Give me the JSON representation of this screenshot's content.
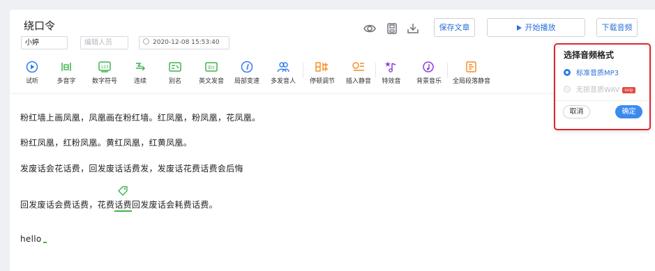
{
  "article": {
    "title": "绕口令",
    "speaker": "小婷",
    "editor_placeholder": "编辑人员",
    "datetime": "2020-12-08 15:53:40"
  },
  "header_buttons": {
    "save": "保存文章",
    "play": "开始播放",
    "download": "下载音频"
  },
  "toolbar": [
    {
      "label": "试听",
      "icon": "play-circle-icon",
      "color": "#2f7df0"
    },
    {
      "label": "多音字",
      "icon": "polyphone-icon",
      "color": "#3fb24f"
    },
    {
      "label": "数字符号",
      "icon": "number-symbol-icon",
      "color": "#3fb24f"
    },
    {
      "label": "连续",
      "icon": "continuous-icon",
      "color": "#3fb24f"
    },
    {
      "label": "别名",
      "icon": "alias-icon",
      "color": "#3fb24f"
    },
    {
      "label": "英文发音",
      "icon": "english-pronounce-icon",
      "color": "#3fb24f"
    },
    {
      "label": "局部变速",
      "icon": "speed-icon",
      "color": "#2f7df0"
    },
    {
      "label": "多发音人",
      "icon": "multi-speaker-icon",
      "color": "#2f7df0"
    },
    {
      "label": "停顿调节",
      "icon": "pause-adjust-icon",
      "color": "#f08a1c"
    },
    {
      "label": "插入静音",
      "icon": "insert-silence-icon",
      "color": "#f08a1c"
    },
    {
      "label": "特效音",
      "icon": "sound-effect-icon",
      "color": "#8a3fd8"
    },
    {
      "label": "背景音乐",
      "icon": "background-music-icon",
      "color": "#8a3fd8"
    },
    {
      "label": "全局段落静音",
      "icon": "paragraph-silence-icon",
      "color": "#f08a1c"
    }
  ],
  "content": {
    "line1": "粉红墙上画凤凰，凤凰画在粉红墙。红凤凰，粉凤凰，花凤凰。",
    "line2": "粉红凤凰，红粉凤凰。黄红凤凰，红黄凤凰。",
    "line3": "发废话会花话费，回发废话话费发，发废话花费话费会后悔",
    "line4_before": "回发废话会费话费，花费",
    "line4_highlight": "话费",
    "line4_after": "回发废话会耗费话费。",
    "line5": "hello"
  },
  "format_popup": {
    "title": "选择音频格式",
    "option_mp3": "标准音质MP3",
    "option_wav": "无损音质WAV",
    "svip_badge": "svip",
    "cancel": "取消",
    "confirm": "确定"
  },
  "colors": {
    "accent_blue": "#2c6fd8",
    "highlight_green": "#3fb24f",
    "popup_border_red": "#e0262a"
  }
}
